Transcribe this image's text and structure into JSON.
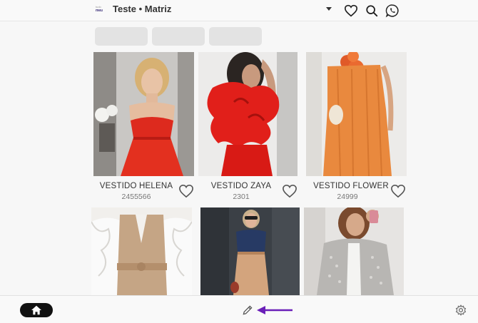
{
  "header": {
    "logo_top": "tudo",
    "logo_bottom": "meu",
    "title": "Teste • Matriz",
    "icons": [
      "chevron-down-icon",
      "heart-icon",
      "search-icon",
      "whatsapp-icon"
    ]
  },
  "filters": {
    "chips": [
      "",
      "",
      ""
    ]
  },
  "products": [
    {
      "name": "VESTIDO HELENA",
      "code": "2455566",
      "photo": "red-dress-photo"
    },
    {
      "name": "VESTIDO ZAYA",
      "code": "2301",
      "photo": "red-ruffle-dress-photo"
    },
    {
      "name": "VESTIDO FLOWER",
      "code": "24999",
      "photo": "orange-dress-photo"
    },
    {
      "name": "",
      "code": "",
      "photo": "beige-vest-outfit-photo"
    },
    {
      "name": "",
      "code": "",
      "photo": "navy-top-beige-pants-photo"
    },
    {
      "name": "",
      "code": "",
      "photo": "sequin-jacket-photo"
    }
  ],
  "bottombar": {
    "icons": [
      "home-icon",
      "pencil-icon",
      "gear-icon"
    ]
  },
  "colors": {
    "accent_arrow": "#6a1fb8",
    "dress_red": "#e0271f",
    "dress_orange": "#e8843a"
  }
}
